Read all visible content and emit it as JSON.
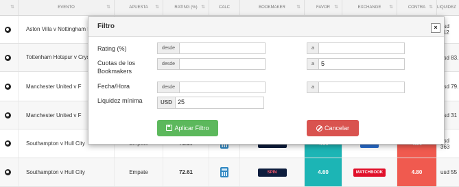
{
  "table": {
    "headers": [
      "",
      "EVENTO",
      "APUESTA",
      "RATING (%)",
      "CALC",
      "BOOKMAKER",
      "FAVOR",
      "EXCHANGE",
      "CONTRA",
      "LIQUIDEZ"
    ],
    "rows": [
      {
        "event": "Aston Villa v Nottingham Forest",
        "bet": "",
        "rating": "",
        "favor": "",
        "exchange": "",
        "contra": "",
        "liquidity": "usd 112"
      },
      {
        "event": "Tottenham Hotspur v Crystal Palace",
        "bet": "",
        "rating": "",
        "favor": "",
        "exchange": "",
        "contra": "",
        "liquidity": "usd 83."
      },
      {
        "event": "Manchester United v F",
        "bet": "",
        "rating": "",
        "favor": "",
        "exchange": "",
        "contra": "",
        "liquidity": "usd 79."
      },
      {
        "event": "Manchester United v F",
        "bet": "",
        "rating": "",
        "favor": "",
        "exchange": "",
        "contra": "",
        "liquidity": "usd 31"
      },
      {
        "event": "Southampton v Hull City",
        "bet": "Empate",
        "rating": "71.10",
        "favor": "4.60",
        "exchange": "Betfair",
        "contra": "4.80",
        "liquidity": "usd 363"
      },
      {
        "event": "Southampton v Hull City",
        "bet": "Empate",
        "rating": "72.61",
        "favor": "4.60",
        "exchange": "MATCHBOOK",
        "contra": "4.80",
        "liquidity": "usd 55"
      }
    ],
    "bookmaker_label": "SPIN"
  },
  "modal": {
    "title": "Filtro",
    "close_label": "×",
    "fields": {
      "rating_label": "Rating (%)",
      "cuotas_label": "Cuotas de los Bookmakers",
      "fecha_label": "Fecha/Hora",
      "liquidez_label": "Liquidez mínima",
      "desde": "desde",
      "a": "a",
      "currency": "USD",
      "rating_from": "",
      "rating_to": "",
      "cuotas_from": "",
      "cuotas_to": "5",
      "fecha_from": "",
      "fecha_to": "",
      "liquidez_value": "25"
    },
    "apply_label": "Aplicar Filtro",
    "cancel_label": "Cancelar"
  },
  "colors": {
    "apply": "#5cb85c",
    "cancel": "#d9534f",
    "favor": "#1cb5b5",
    "contra": "#f05a4f"
  }
}
